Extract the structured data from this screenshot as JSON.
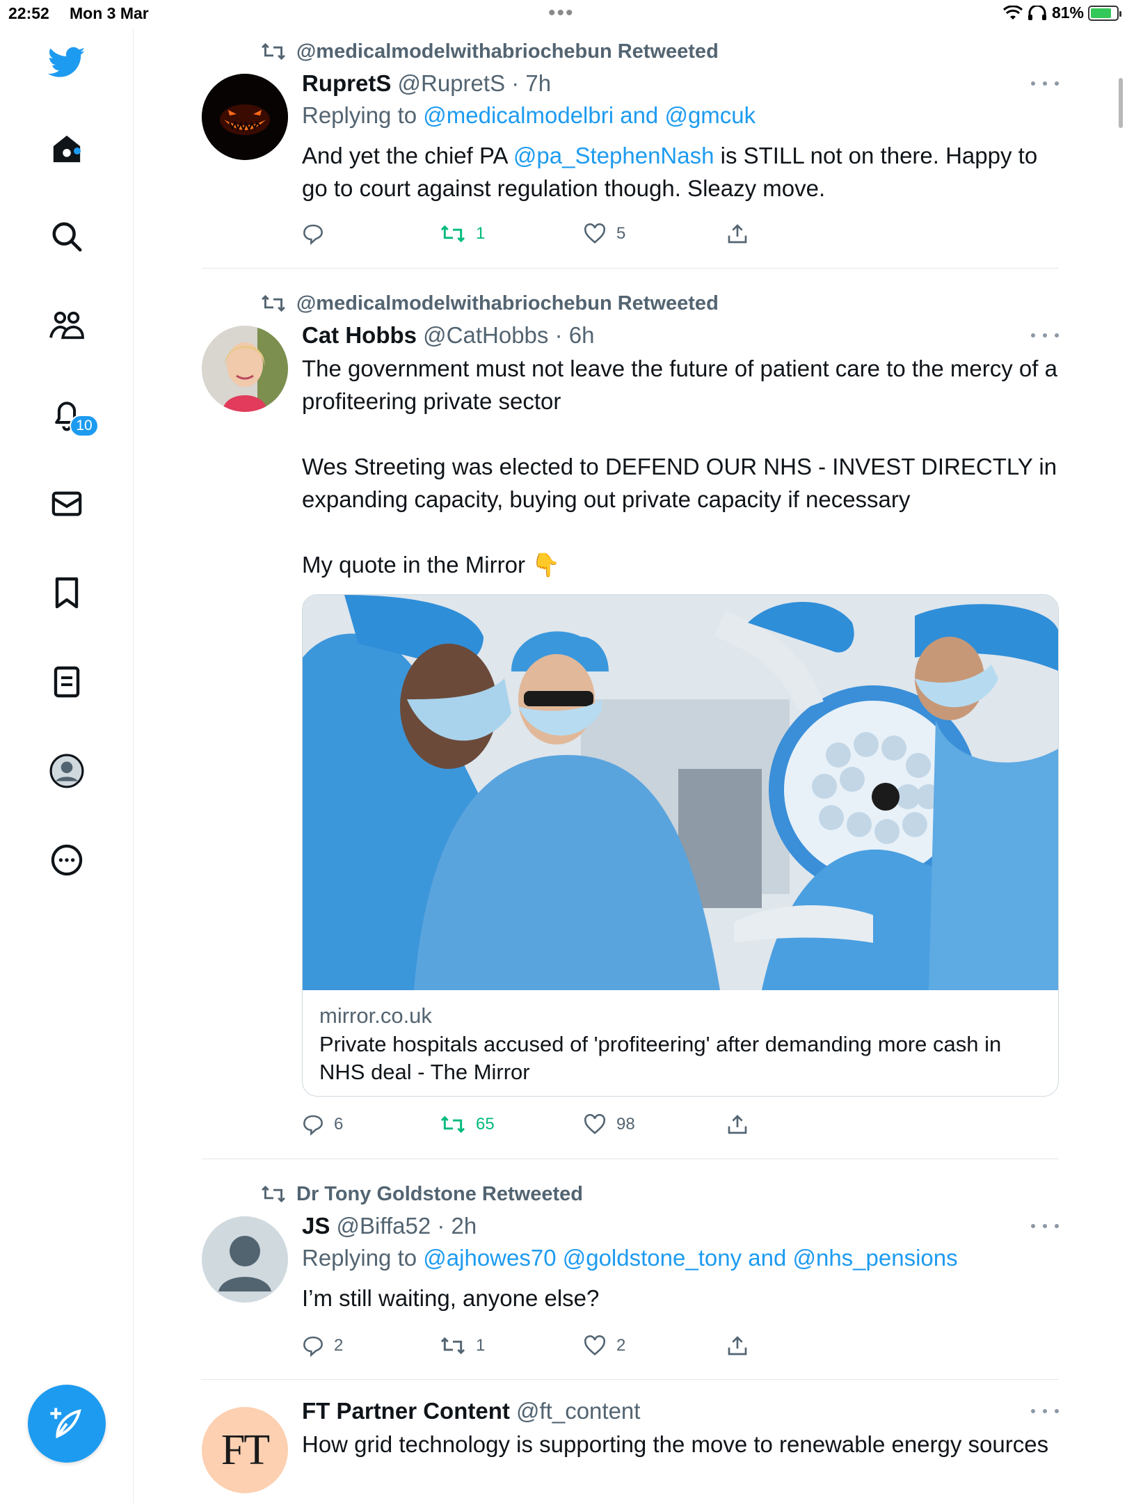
{
  "status_bar": {
    "time": "22:52",
    "date": "Mon 3 Mar",
    "battery": "81%",
    "battery_level": 0.81
  },
  "sidebar": {
    "notifications_badge": "10"
  },
  "tweets": [
    {
      "retweeted_by": "@medicalmodelwithabriochebun Retweeted",
      "name": "RupretS",
      "meta": "@RupretS · 7h",
      "reply_prefix": "Replying to",
      "reply_to": "@medicalmodelbri and @gmcuk",
      "body_pre": "And yet the chief PA ",
      "body_link": "@pa_StephenNash",
      "body_post": " is STILL not on there. Happy to go to court against regulation though. Sleazy move.",
      "replies": "",
      "retweets": "1",
      "likes": "5"
    },
    {
      "retweeted_by": "@medicalmodelwithabriochebun Retweeted",
      "name": "Cat Hobbs",
      "meta": "@CatHobbs · 6h",
      "body_p1": "The government must not leave the future of patient care to the mercy of a profiteering private sector",
      "body_p2": "Wes Streeting was elected to DEFEND OUR NHS - INVEST DIRECTLY in expanding capacity, buying out private capacity if necessary",
      "body_p3": "My quote in the Mirror 👇",
      "card_domain": "mirror.co.uk",
      "card_title": "Private hospitals accused of 'profiteering' after demanding more cash in NHS deal - The Mirror",
      "replies": "6",
      "retweets": "65",
      "likes": "98"
    },
    {
      "retweeted_by": "Dr Tony Goldstone Retweeted",
      "name": "JS",
      "meta": "@Biffa52 · 2h",
      "reply_prefix": "Replying to",
      "reply_to": "@ajhowes70 @goldstone_tony and @nhs_pensions",
      "body": "I’m still waiting, anyone else?",
      "replies": "2",
      "retweets": "1",
      "likes": "2"
    },
    {
      "name": "FT Partner Content",
      "meta": "@ft_content",
      "avatar_text": "FT",
      "body": "How grid technology is supporting the move to renewable energy sources"
    }
  ],
  "colors": {
    "accent": "#1d9bf0",
    "retweet_green": "#00ba7c",
    "muted": "#536471"
  },
  "icons": [
    "twitter-bird-icon",
    "home-icon",
    "search-icon",
    "communities-icon",
    "bell-icon",
    "mail-icon",
    "bookmark-icon",
    "lists-icon",
    "profile-icon",
    "more-circle-icon",
    "compose-icon",
    "retweet-icon",
    "reply-icon",
    "like-icon",
    "share-icon",
    "more-dots-icon",
    "wifi-icon",
    "headphones-icon",
    "battery-icon"
  ]
}
